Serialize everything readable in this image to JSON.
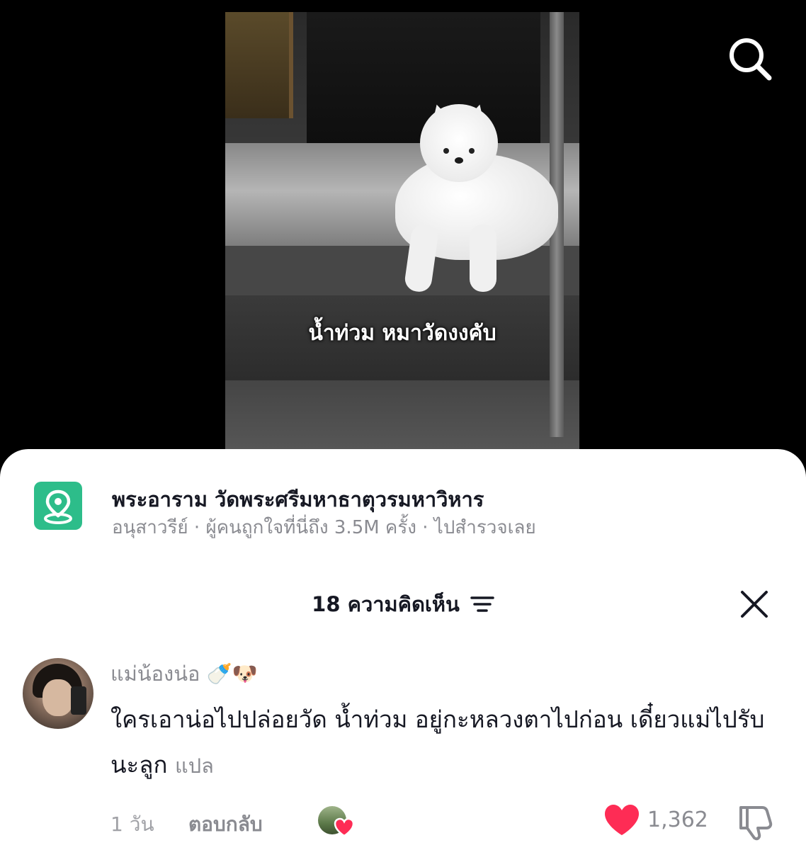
{
  "video": {
    "caption": "น้ำท่วม หมาวัดงงคับ"
  },
  "search": {
    "icon": "search-icon"
  },
  "place": {
    "icon": "map-pin-icon",
    "title": "พระอาราม วัดพระศรีมหาธาตุวรมหาวิหาร",
    "area": "อนุสาวรีย์",
    "stat": "ผู้คนถูกใจที่นี่ถึง 3.5M ครั้ง",
    "cta": "ไปสำรวจเลย",
    "separator": "·",
    "accent_color": "#2dbd8a"
  },
  "comments_header": {
    "count_label": "18 ความคิดเห็น",
    "sort_icon": "sort-lines-icon",
    "close_icon": "close-icon"
  },
  "comment": {
    "username": "แม่น้องน่อ 🍼🐶",
    "text": "ใครเอาน่อไปปล่อยวัด น้ำท่วม อยู่กะหลวงตาไปก่อน เดี๋ยวแม่ไปรับนะลูก",
    "translate_label": "แปล",
    "time": "1 วัน",
    "reply_label": "ตอบกลับ",
    "like_count": "1,362",
    "liked": true,
    "like_color": "#fe2c55"
  }
}
